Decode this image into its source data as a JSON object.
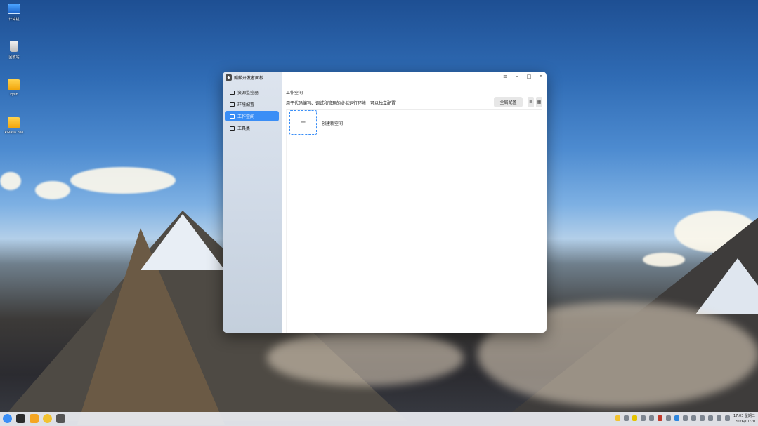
{
  "desktop": {
    "icons": [
      {
        "label": "计算机"
      },
      {
        "label": "回收站"
      },
      {
        "label": "kylin"
      },
      {
        "label": "kiRasa.nas"
      }
    ]
  },
  "window": {
    "app_name": "麒麟开发者面板",
    "nav": [
      {
        "label": "资源监控器"
      },
      {
        "label": "环境配置"
      },
      {
        "label": "工作空间"
      },
      {
        "label": "工具集"
      }
    ],
    "controls": {
      "menu": "≡",
      "minimize": "–",
      "maximize": "□",
      "close": "✕"
    },
    "main": {
      "title": "工作空间",
      "description": "用于代码编写、调试和管理的虚拟运行环境，可以独立配置",
      "global_config_label": "全局配置",
      "view_list_icon": "≣",
      "view_grid_icon": "▦",
      "add_symbol": "+",
      "create_label": "创建新空间"
    }
  },
  "taskbar": {
    "time": "17:03 星期二",
    "date": "2026/01/20"
  },
  "colors": {
    "accent": "#3a8ef6"
  }
}
